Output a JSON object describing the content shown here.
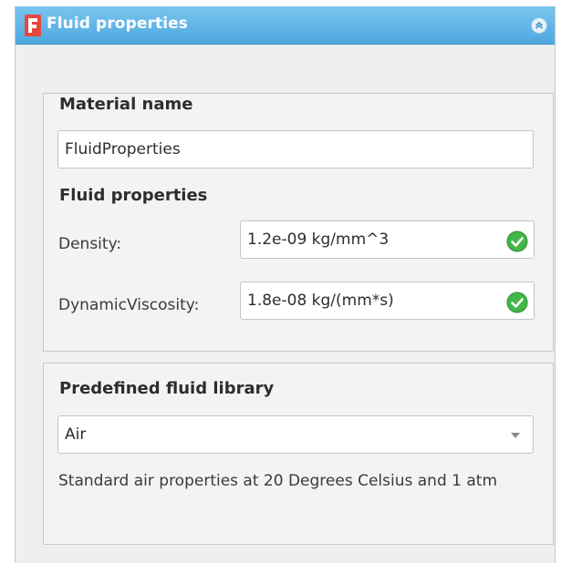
{
  "panel": {
    "title": "Fluid properties",
    "icon": "freecad-f-icon"
  },
  "material": {
    "heading": "Material name",
    "name_value": "FluidProperties"
  },
  "fluid_props": {
    "heading": "Fluid properties",
    "density_label": "Density:",
    "density_value": "1.2e-09 kg/mm^3",
    "viscosity_label": "DynamicViscosity:",
    "viscosity_value": "1.8e-08 kg/(mm*s)"
  },
  "library": {
    "heading": "Predefined fluid library",
    "selected": "Air",
    "description": "Standard air properties at 20 Degrees Celsius and 1 atm"
  },
  "colors": {
    "title_bar": "#4fa8df",
    "valid_check": "#43b649",
    "icon_red": "#e7473d"
  }
}
